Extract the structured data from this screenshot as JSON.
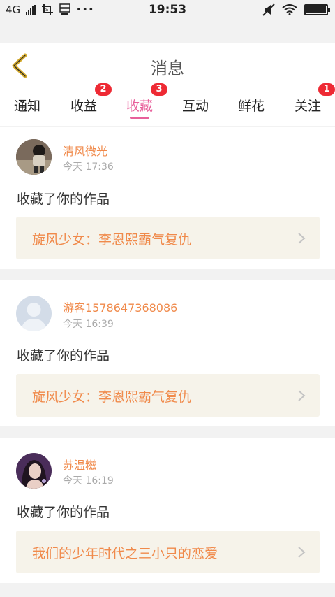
{
  "status_bar": {
    "network": "4G",
    "time": "19:53",
    "icons": [
      "signal-icon",
      "screenshot-icon",
      "storage-icon",
      "more-dots-icon",
      "mute-icon",
      "wifi-icon",
      "battery-icon"
    ],
    "more_dots": "•••"
  },
  "header": {
    "title": "消息",
    "back_icon": "back-chevron-icon",
    "back_color": "#d4a92a"
  },
  "tabs": [
    {
      "label": "通知",
      "badge": ""
    },
    {
      "label": "收益",
      "badge": "2"
    },
    {
      "label": "收藏",
      "badge": "3",
      "active": true
    },
    {
      "label": "互动",
      "badge": ""
    },
    {
      "label": "鲜花",
      "badge": ""
    },
    {
      "label": "关注",
      "badge": "1"
    }
  ],
  "messages": [
    {
      "user": "清风微光",
      "time": "今天 17:36",
      "text": "收藏了你的作品",
      "work": "旋风少女：李恩熙霸气复仇",
      "avatar": "avatar-photo-child"
    },
    {
      "user": "游客1578647368086",
      "time": "今天 16:39",
      "text": "收藏了你的作品",
      "work": "旋风少女：李恩熙霸气复仇",
      "avatar": "avatar-default-guest"
    },
    {
      "user": "苏温糍",
      "time": "今天 16:19",
      "text": "收藏了你的作品",
      "work": "我们的少年时代之三小只的恋爱",
      "avatar": "avatar-photo-girl"
    }
  ],
  "colors": {
    "accent": "#e8609b",
    "username": "#f08a4b",
    "badge": "#ee2a34",
    "work_bg": "#f6f3ea"
  }
}
